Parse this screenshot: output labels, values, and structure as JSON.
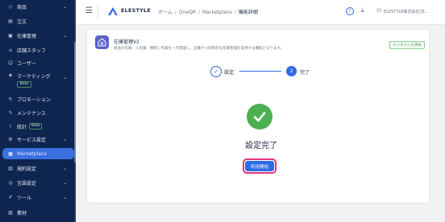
{
  "sidebar": {
    "items": [
      {
        "label": "商品",
        "icon": "tag-icon",
        "chevron": true
      },
      {
        "label": "注文",
        "icon": "receipt-icon",
        "chevron": false
      },
      {
        "label": "在庫管理",
        "icon": "box-icon",
        "chevron": true
      },
      {
        "label": "店舗スタッフ",
        "icon": "store-icon",
        "chevron": false
      },
      {
        "label": "ユーザー",
        "icon": "user-icon",
        "chevron": false
      },
      {
        "label": "マーケティング",
        "icon": "marketing-icon",
        "chevron": true,
        "badge": "Beta"
      },
      {
        "label": "プロモーション",
        "icon": "promotion-icon",
        "chevron": false
      },
      {
        "label": "メンテナンス",
        "icon": "wrench-icon",
        "chevron": false
      },
      {
        "label": "統計",
        "icon": "stats-icon",
        "chevron": false,
        "badge": "Beta"
      },
      {
        "label": "サービス設定",
        "icon": "gear-icon",
        "chevron": true
      },
      {
        "label": "Marketplace",
        "icon": "grid-icon",
        "chevron": false,
        "active": true
      },
      {
        "label": "規約設定",
        "icon": "policy-icon",
        "chevron": true
      },
      {
        "label": "言語設定",
        "icon": "globe-icon",
        "chevron": true
      },
      {
        "label": "ツール",
        "icon": "tool-icon",
        "chevron": true
      },
      {
        "label": "素材",
        "icon": "image-icon",
        "chevron": false
      }
    ]
  },
  "header": {
    "brand": "ELESTYLE",
    "breadcrumb": [
      "ホーム",
      "OneQR",
      "Marketplace",
      "機能詳細"
    ],
    "company": "ELESTYLE株式会社[本..."
  },
  "app": {
    "title": "在庫管理V2",
    "description": "商品の在庫、入出庫、棚卸し作業を一元管理し、正確かつ効率的な在庫管理を実現する機能となります。",
    "status_badge": "インストール済み"
  },
  "steps": {
    "step1_label": "設定",
    "step2_number": "2",
    "step2_label": "完了"
  },
  "result": {
    "message": "設定完了",
    "button_label": "利用開始"
  },
  "colors": {
    "sidebar_bg": "#0e2550",
    "accent": "#2e6be6",
    "success": "#4caf50",
    "highlight": "#e0357e"
  }
}
